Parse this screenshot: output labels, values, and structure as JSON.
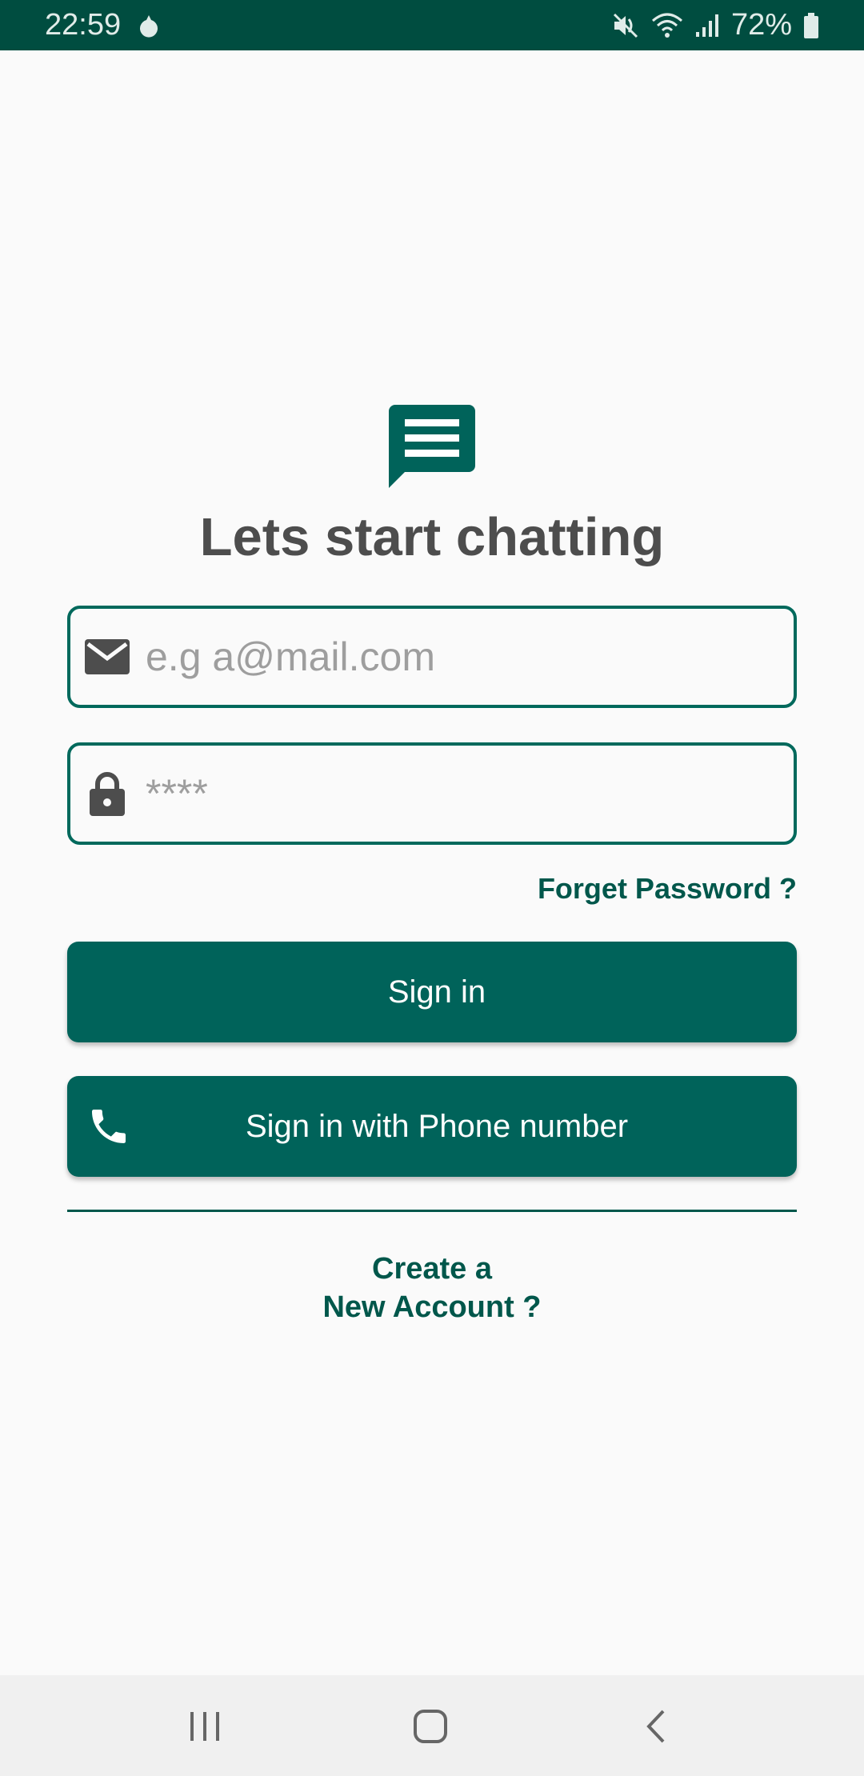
{
  "status_bar": {
    "time": "22:59",
    "battery_percent": "72%"
  },
  "login": {
    "headline": "Lets start chatting",
    "email_placeholder": "e.g a@mail.com",
    "password_placeholder": "****",
    "forget_password": "Forget Password ?",
    "signin_label": "Sign in",
    "phone_signin_label": "Sign in with Phone number",
    "create_account_line1": "Create a",
    "create_account_line2": "New Account ?"
  },
  "icons": {
    "logo": "chat-message-icon",
    "email": "envelope-icon",
    "password": "lock-icon",
    "phone": "phone-icon",
    "nav_recents": "recents-icon",
    "nav_home": "home-icon",
    "nav_back": "back-icon"
  },
  "colors": {
    "primary": "#00635a",
    "status_bar": "#004d40",
    "link": "#00574b",
    "headline": "#4d4d4d",
    "background": "#fafafa"
  }
}
